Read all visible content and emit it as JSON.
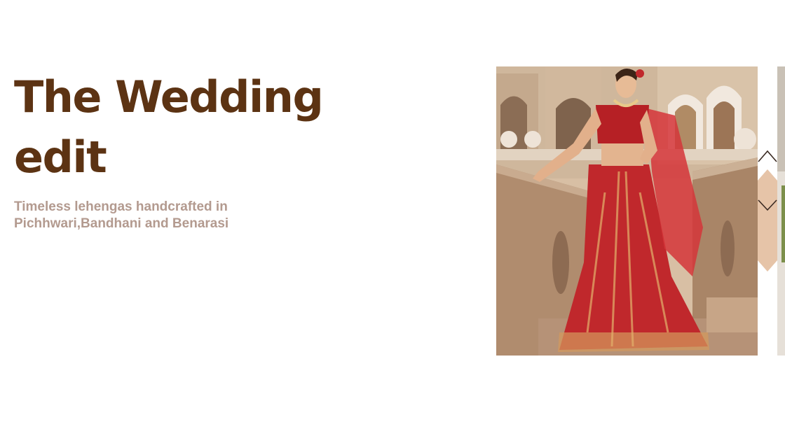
{
  "hero": {
    "title": "The Wedding edit",
    "subtitle": "Timeless lehengas handcrafted in Pichhwari,Bandhani and Benarasi"
  },
  "carousel": {
    "slides": [
      {
        "image": "model in red embroidered bridal lehenga on terrace"
      },
      {
        "image": "partially visible next slide"
      }
    ],
    "controls": {
      "up_icon": "chevron-up-icon",
      "down_icon": "chevron-down-icon"
    }
  },
  "colors": {
    "title": "#5c3313",
    "subtitle": "#b39a8f",
    "accent": "#e6c4a8",
    "lehenga": "#c0282c"
  }
}
